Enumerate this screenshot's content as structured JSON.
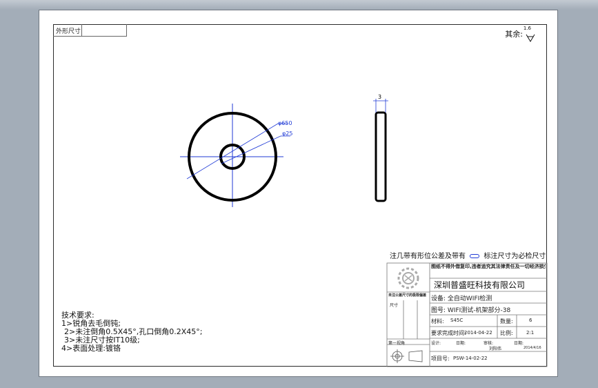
{
  "external_dims_label": "外形尺寸",
  "rest_label": "其余:",
  "roughness_value": "1.6",
  "drawing": {
    "dim_outer": "φ650",
    "dim_inner": "φ25",
    "dim_thickness": "3"
  },
  "note": {
    "text_a": "注几带有形位公差及带有",
    "text_b": "标注尺寸为必检尺寸"
  },
  "tech": {
    "title": "技术要求:",
    "items": [
      "1>锐角去毛倒钝;",
      "2>未注倒角0.5X45°,孔口倒角0.2X45°;",
      "3>未注尺寸按IT10级;",
      "4>表面处理:镀铬"
    ]
  },
  "title_block": {
    "header_note": "图纸不得外借复印,违者追究其法律责任及一切经济损失",
    "company": "深圳普盛旺科技有限公司",
    "device": "设备: 全自动WIFI检测",
    "drawing_no": "图号: WIFI测试-机架部分-38",
    "material_label": "材料:",
    "material_value": "S45C",
    "qty_label": "数量:",
    "qty_value": "6",
    "due_label": "要求完成时间:",
    "due_value": "2014-04-22",
    "scale_label": "比例:",
    "scale_value": "2:1",
    "designer_label": "设计:",
    "checker_label": "审核:",
    "date_label": "日期:",
    "date_label2": "日期:",
    "signer": "刘阳伟",
    "sign_date": "2014/4/16",
    "project_label": "项目号:",
    "project_value": "PSW-14-02-22",
    "tolerance_title": "未注公差尺寸的极限偏差",
    "tolerance_header": "尺寸",
    "projection": "第一视角"
  }
}
